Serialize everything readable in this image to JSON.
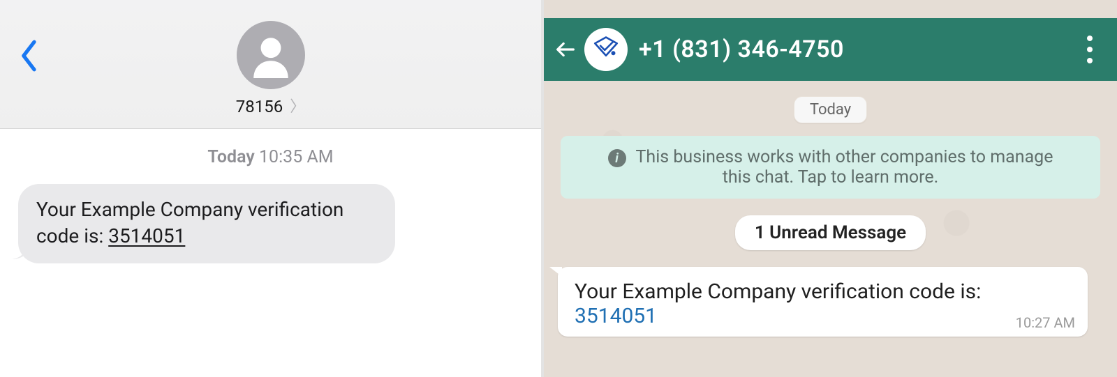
{
  "sms": {
    "sender_shortcode": "78156",
    "timestamp_day": "Today",
    "timestamp_time": "10:35 AM",
    "message_prefix": "Your Example Company verification code is: ",
    "verification_code": "3514051"
  },
  "whatsapp": {
    "contact_number": "+1 (831) 346-4750",
    "date_label": "Today",
    "business_info_line1": "This business works with other companies to manage",
    "business_info_line2": "this chat. Tap to learn more.",
    "unread_label": "1 Unread Message",
    "message_prefix": "Your Example Company verification code is:",
    "verification_code": "3514051",
    "message_time": "10:27 AM",
    "brand_color": "#2B7D6B"
  }
}
